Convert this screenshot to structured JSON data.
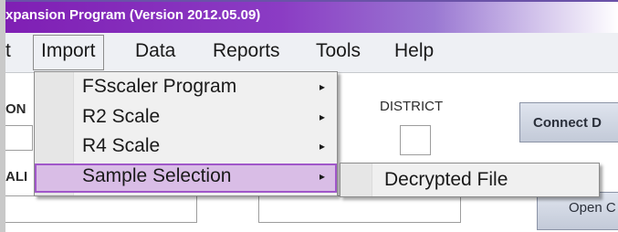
{
  "window": {
    "title": "xpansion Program (Version 2012.05.09)"
  },
  "menubar": {
    "items": [
      {
        "label": "t"
      },
      {
        "label": "Import"
      },
      {
        "label": "Data"
      },
      {
        "label": "Reports"
      },
      {
        "label": "Tools"
      },
      {
        "label": "Help"
      }
    ]
  },
  "form": {
    "left_label_1": "ON",
    "left_label_2": "ALI",
    "district_label": "DISTRICT",
    "connect_button": "Connect D",
    "open_button": "Open C"
  },
  "import_menu": {
    "items": [
      {
        "label": "FSscaler Program",
        "arrow": "▸"
      },
      {
        "label": "R2 Scale",
        "arrow": "▸"
      },
      {
        "label": "R4 Scale",
        "arrow": "▸"
      },
      {
        "label": "Sample Selection",
        "arrow": "▸"
      }
    ]
  },
  "submenu": {
    "items": [
      {
        "label": "Decrypted File"
      }
    ]
  },
  "colors": {
    "title_accent": "#7f1fb4",
    "highlight": "#d9bde6",
    "highlight_border": "#a057c9"
  },
  "icons": {
    "submenu_arrow": "chevron-right-icon"
  }
}
